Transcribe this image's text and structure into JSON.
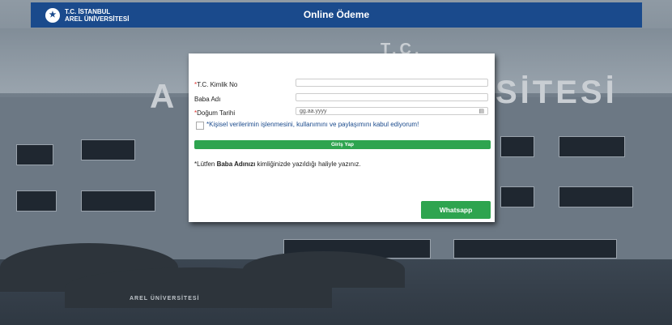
{
  "header": {
    "logo_line1": "T.C. İSTANBUL",
    "logo_line2": "AREL ÜNİVERSİTESİ",
    "title": "Online Ödeme"
  },
  "form": {
    "tc_label": "T.C. Kimlik No",
    "tc_value": "",
    "father_label": "Baba Adı",
    "father_value": "",
    "dob_label": "Doğum Tarihi",
    "dob_placeholder": "gg.aa.yyyy",
    "required_mark": "*",
    "consent_text": "*Kişisel verilerimin işlenmesini, kullanımını ve paylaşımını kabul ediyorum!",
    "login_button": "Giriş Yap",
    "note_prefix": "*Lütfen ",
    "note_bold": "Baba Adınızı",
    "note_suffix": " kimliğinizde yazıldığı haliyle yazınız.",
    "whatsapp_button": "Whatsapp"
  },
  "background": {
    "sign_text": "SİTESİ",
    "sign_left": "A",
    "umbrella_text": "AREL ÜNİVERSİTESİ",
    "tc_text": "T.C."
  },
  "colors": {
    "header_bg": "#1a4a8c",
    "button_green": "#2ea44f",
    "required_red": "#e0302b"
  }
}
